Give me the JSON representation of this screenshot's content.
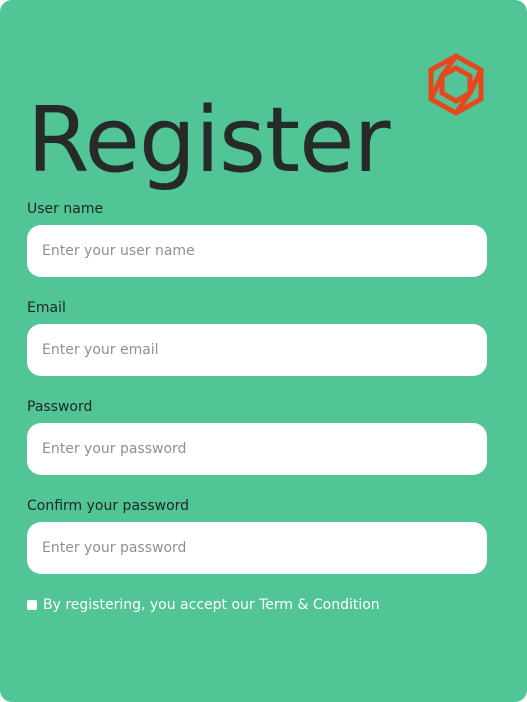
{
  "form": {
    "title": "Register",
    "fields": [
      {
        "label": "User name",
        "placeholder": "Enter your user name",
        "value": ""
      },
      {
        "label": "Email",
        "placeholder": "Enter your email",
        "value": ""
      },
      {
        "label": "Password",
        "placeholder": "Enter your password",
        "value": ""
      },
      {
        "label": "Confirm your password",
        "placeholder": "Enter your password",
        "value": ""
      }
    ],
    "terms_text": "By registering, you accept our Term & Condition"
  },
  "logo": {
    "icon": "hexagon-logo-icon",
    "color": "#e5481f"
  },
  "colors": {
    "background": "#51c595",
    "input_background": "#ffffff",
    "title_text": "#262b2a",
    "label_text": "#1f2624",
    "placeholder_text": "#8b9290",
    "terms_text": "#ffffff"
  }
}
